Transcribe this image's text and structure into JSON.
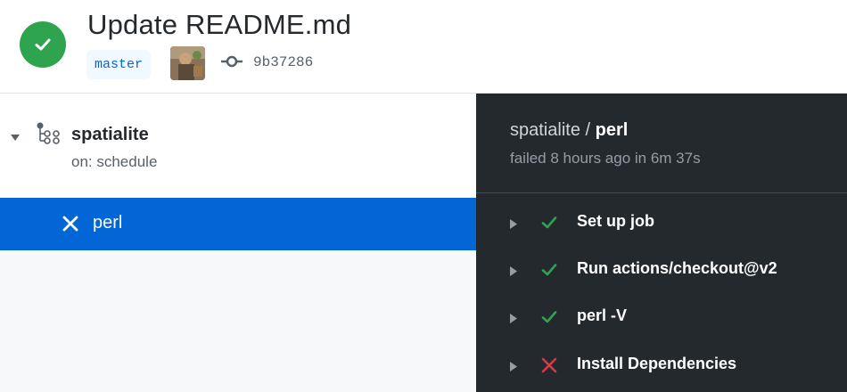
{
  "header": {
    "title": "Update README.md",
    "branch": "master",
    "commit_sha": "9b37286",
    "status": "success",
    "status_color": "#2ea44f"
  },
  "workflow": {
    "name": "spatialite",
    "trigger": "on: schedule",
    "jobs": [
      {
        "name": "perl",
        "status": "failed",
        "selected": true
      }
    ]
  },
  "job_detail": {
    "workflow_name": "spatialite",
    "separator": " / ",
    "job_name": "perl",
    "status_text": "failed 8 hours ago in 6m 37s",
    "steps": [
      {
        "name": "Set up job",
        "status": "success"
      },
      {
        "name": "Run actions/checkout@v2",
        "status": "success"
      },
      {
        "name": "perl -V",
        "status": "success"
      },
      {
        "name": "Install Dependencies",
        "status": "failed"
      }
    ]
  },
  "colors": {
    "accent": "#0366d6",
    "success": "#2ea44f",
    "failure": "#d73a49",
    "dark_panel": "#24292e"
  }
}
